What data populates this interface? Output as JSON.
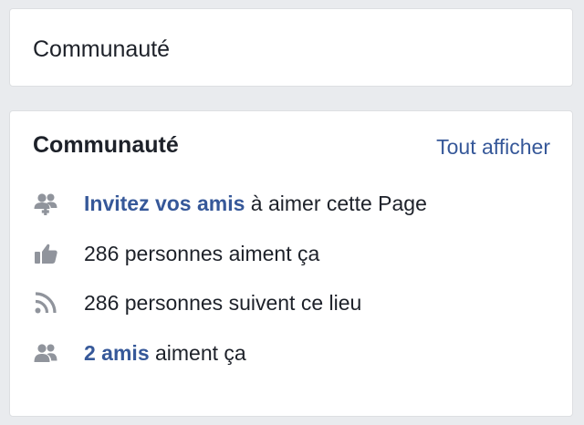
{
  "tab": {
    "label": "Communauté"
  },
  "community": {
    "title": "Communauté",
    "see_all": "Tout afficher",
    "invite": {
      "icon": "invite-friends-icon",
      "link": "Invitez vos amis",
      "rest": " à aimer cette Page"
    },
    "likes": {
      "icon": "thumbs-up-icon",
      "text": "286 personnes aiment ça"
    },
    "followers": {
      "icon": "rss-follow-icon",
      "text": "286 personnes suivent ce lieu"
    },
    "friends": {
      "icon": "friends-icon",
      "link": "2 amis",
      "rest": " aiment ça"
    }
  },
  "colors": {
    "link": "#365899",
    "icon": "#90949c",
    "background": "#e9ebee"
  }
}
